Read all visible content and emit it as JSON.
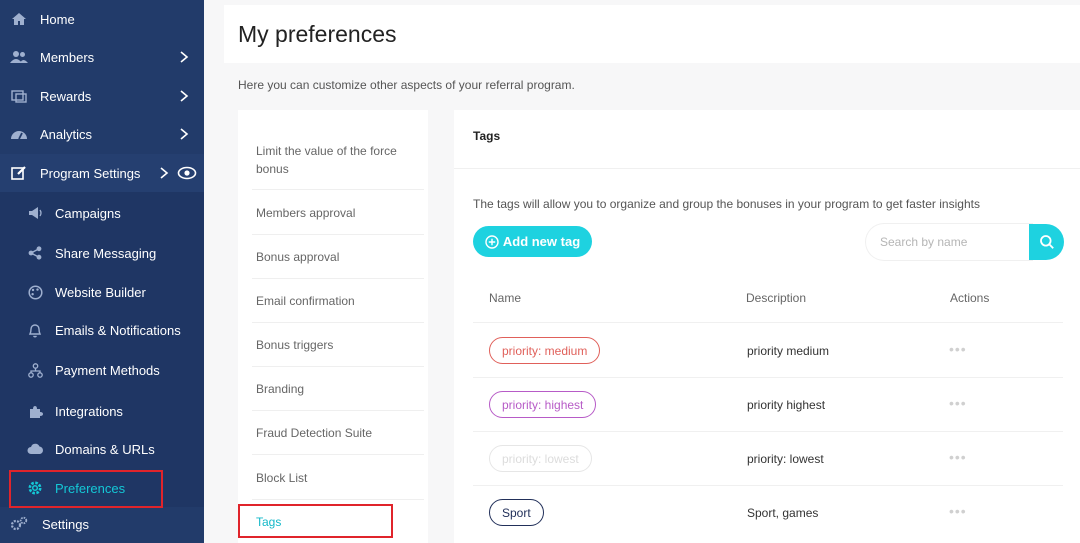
{
  "sidebar": {
    "items": [
      {
        "label": "Home",
        "icon": "home-icon"
      },
      {
        "label": "Members",
        "icon": "users-icon"
      },
      {
        "label": "Rewards",
        "icon": "rewards-icon"
      },
      {
        "label": "Analytics",
        "icon": "analytics-icon"
      },
      {
        "label": "Program Settings",
        "icon": "edit-icon"
      }
    ],
    "sub_items": [
      {
        "label": "Campaigns",
        "icon": "megaphone-icon"
      },
      {
        "label": "Share Messaging",
        "icon": "share-icon"
      },
      {
        "label": "Website Builder",
        "icon": "palette-icon"
      },
      {
        "label": "Emails & Notifications",
        "icon": "bell-icon"
      },
      {
        "label": "Payment Methods",
        "icon": "payment-icon"
      },
      {
        "label": "Integrations",
        "icon": "puzzle-icon"
      },
      {
        "label": "Domains & URLs",
        "icon": "cloud-icon"
      },
      {
        "label": "Preferences",
        "icon": "gear-icon"
      }
    ],
    "settings_label": "Settings"
  },
  "main": {
    "title": "My preferences",
    "subtitle": "Here you can customize other aspects of your referral program.",
    "pref_items": [
      "Limit the value of the force bonus",
      "Members approval",
      "Bonus approval",
      "Email confirmation",
      "Bonus triggers",
      "Branding",
      "Fraud Detection Suite",
      "Block List",
      "Tags"
    ],
    "tags": {
      "title": "Tags",
      "description": "The tags will allow you to organize and group the bonuses in your program to get faster insights",
      "add_button": "Add new tag",
      "search_placeholder": "Search by name",
      "columns": [
        "Name",
        "Description",
        "Actions"
      ],
      "rows": [
        {
          "name": "priority: medium",
          "description": "priority medium",
          "color": "#e0605a"
        },
        {
          "name": "priority: highest",
          "description": "priority highest",
          "color": "#b75bc7"
        },
        {
          "name": "priority: lowest",
          "description": "priority: lowest",
          "color": "#e0e0e0"
        },
        {
          "name": "Sport",
          "description": "Sport, games",
          "color": "#22305a"
        }
      ],
      "actions_label": "•••"
    }
  },
  "colors": {
    "sidebar": "#223b6a",
    "accent": "#1ed2e0",
    "highlight": "#e0242b"
  }
}
